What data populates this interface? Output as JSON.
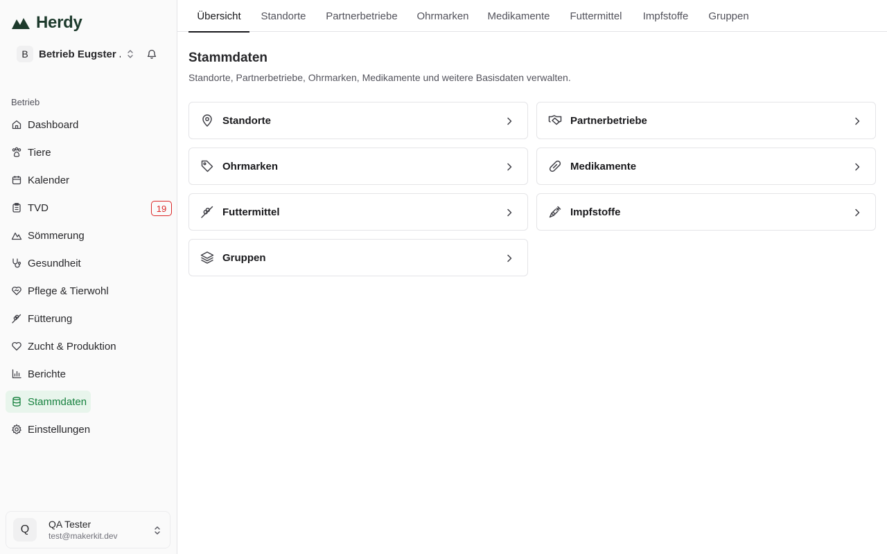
{
  "brand": {
    "name": "Herdy",
    "color": "#1d3a2c"
  },
  "workspace": {
    "initial": "B",
    "name": "Betrieb Eugster ..."
  },
  "sidebar": {
    "section_label": "Betrieb",
    "items": [
      {
        "label": "Dashboard",
        "icon": "home-icon"
      },
      {
        "label": "Tiere",
        "icon": "paw-icon"
      },
      {
        "label": "Kalender",
        "icon": "calendar-icon"
      },
      {
        "label": "TVD",
        "icon": "clipboard-icon",
        "badge": "19"
      },
      {
        "label": "Sömmerung",
        "icon": "mountain-icon"
      },
      {
        "label": "Gesundheit",
        "icon": "stethoscope-icon"
      },
      {
        "label": "Pflege & Tierwohl",
        "icon": "heart-handshake-icon"
      },
      {
        "label": "Fütterung",
        "icon": "wheat-icon"
      },
      {
        "label": "Zucht & Produktion",
        "icon": "heart-icon"
      },
      {
        "label": "Berichte",
        "icon": "bar-chart-icon"
      },
      {
        "label": "Stammdaten",
        "icon": "database-icon",
        "active": true
      },
      {
        "label": "Einstellungen",
        "icon": "gear-icon"
      }
    ]
  },
  "user": {
    "initial": "Q",
    "name": "QA Tester",
    "email": "test@makerkit.dev"
  },
  "tabs": [
    {
      "label": "Übersicht",
      "active": true
    },
    {
      "label": "Standorte"
    },
    {
      "label": "Partnerbetriebe"
    },
    {
      "label": "Ohrmarken"
    },
    {
      "label": "Medikamente"
    },
    {
      "label": "Futtermittel"
    },
    {
      "label": "Impfstoffe"
    },
    {
      "label": "Gruppen"
    }
  ],
  "main": {
    "title": "Stammdaten",
    "subtitle": "Standorte, Partnerbetriebe, Ohrmarken, Medikamente und weitere Basisdaten verwalten.",
    "cards": [
      {
        "label": "Standorte",
        "icon": "map-pin-icon"
      },
      {
        "label": "Partnerbetriebe",
        "icon": "handshake-icon"
      },
      {
        "label": "Ohrmarken",
        "icon": "tag-icon"
      },
      {
        "label": "Medikamente",
        "icon": "pill-icon"
      },
      {
        "label": "Futtermittel",
        "icon": "wheat-icon"
      },
      {
        "label": "Impfstoffe",
        "icon": "syringe-icon"
      },
      {
        "label": "Gruppen",
        "icon": "layers-icon"
      }
    ]
  },
  "colors": {
    "accent": "#15803d",
    "accent_bg": "#e8f5ec",
    "badge": "#dc2626"
  }
}
